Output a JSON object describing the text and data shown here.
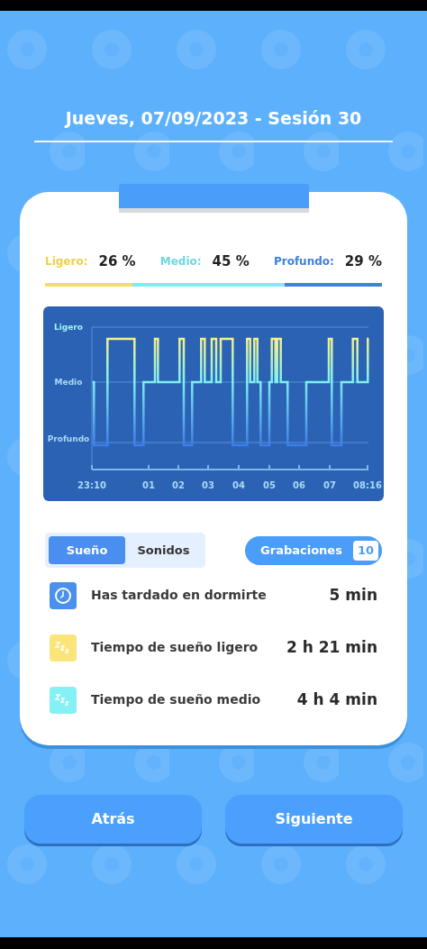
{
  "header": {
    "title": "Jueves, 07/09/2023 - Sesión 30"
  },
  "stages": [
    {
      "kind": "light",
      "label": "Ligero:",
      "value": "26 %",
      "color": "#f5dd6b"
    },
    {
      "kind": "medium",
      "label": "Medio:",
      "value": "45 %",
      "color": "#7eecf0"
    },
    {
      "kind": "deep",
      "label": "Profundo:",
      "value": "29 %",
      "color": "#4080e0"
    }
  ],
  "chart": {
    "y_labels": [
      "Ligero",
      "Medio",
      "Profundo"
    ],
    "x_labels": [
      "23:10",
      "01",
      "02",
      "03",
      "04",
      "05",
      "06",
      "07",
      "08:16"
    ]
  },
  "tabs": [
    {
      "label": "Sueño",
      "selected": true
    },
    {
      "label": "Sonidos",
      "selected": false
    }
  ],
  "recordings": {
    "label": "Grabaciones",
    "count": "10"
  },
  "stats": [
    {
      "kind": "clock",
      "label": "Has tardado en dormirte",
      "value": "5 min"
    },
    {
      "kind": "light_sleep",
      "label": "Tiempo de sueño ligero",
      "value": "2 h 21 min"
    },
    {
      "kind": "medium_sleep",
      "label": "Tiempo de sueño medio",
      "value": "4 h 4 min"
    }
  ],
  "buttons": [
    {
      "label": "Atrás"
    },
    {
      "label": "Siguiente"
    }
  ]
}
